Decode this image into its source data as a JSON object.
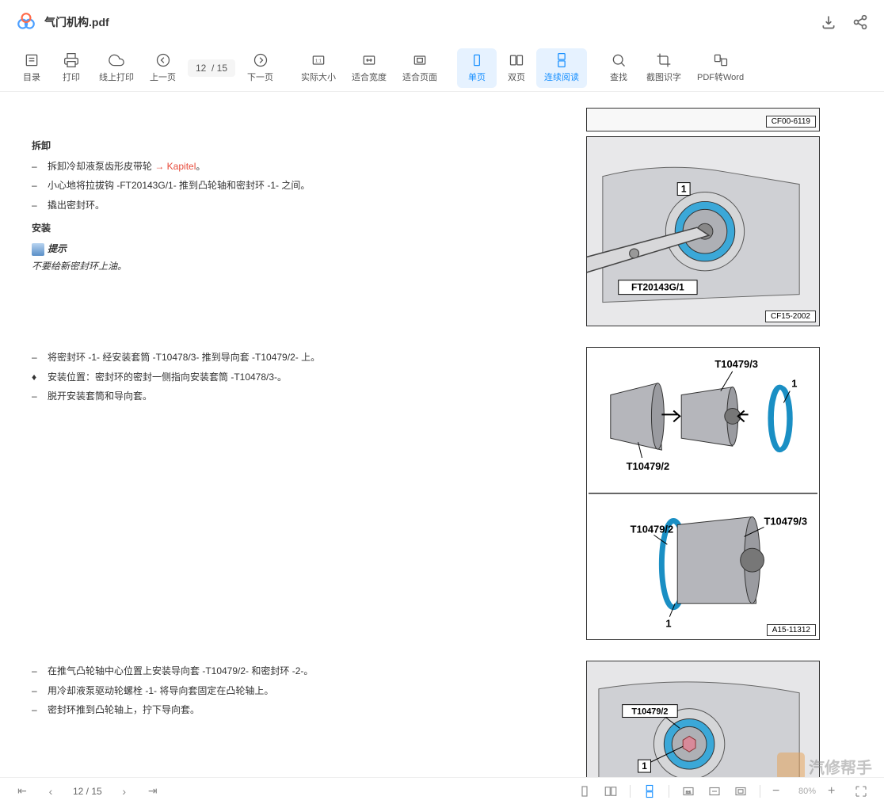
{
  "header": {
    "filename": "气门机构.pdf"
  },
  "toolbar": {
    "items": [
      {
        "label": "目录",
        "icon": "toc"
      },
      {
        "label": "打印",
        "icon": "print"
      },
      {
        "label": "线上打印",
        "icon": "cloud-print"
      },
      {
        "label": "上一页",
        "icon": "prev"
      }
    ],
    "page_display": "12  / 15",
    "items2": [
      {
        "label": "下一页",
        "icon": "next"
      },
      {
        "label": "实际大小",
        "icon": "actual"
      },
      {
        "label": "适合宽度",
        "icon": "fit-width"
      },
      {
        "label": "适合页面",
        "icon": "fit-page"
      },
      {
        "label": "单页",
        "icon": "single",
        "active": true
      },
      {
        "label": "双页",
        "icon": "double"
      },
      {
        "label": "连续阅读",
        "icon": "continuous",
        "active": true
      },
      {
        "label": "查找",
        "icon": "search"
      },
      {
        "label": "截图识字",
        "icon": "crop"
      },
      {
        "label": "PDF转Word",
        "icon": "convert"
      }
    ]
  },
  "document": {
    "section1": {
      "heading1": "拆卸",
      "items1": [
        {
          "text_pre": "拆卸冷却液泵齿形皮带轮 ",
          "link": "→ Kapitel",
          "text_post": "。"
        },
        {
          "text": "小心地将拉拔钩 -FT20143G/1- 推到凸轮轴和密封环 -1- 之间。"
        },
        {
          "text": "撬出密封环。"
        }
      ],
      "heading2": "安装",
      "note_title": "提示",
      "note_text": "不要给新密封环上油。"
    },
    "section2": {
      "items": [
        {
          "bullet": "–",
          "text": "将密封环 -1- 经安装套筒 -T10478/3- 推到导向套 -T10479/2- 上。"
        },
        {
          "bullet": "♦",
          "text": "安装位置：密封环的密封一侧指向安装套筒 -T10478/3-。"
        },
        {
          "bullet": "–",
          "text": "脱开安装套筒和导向套。"
        }
      ]
    },
    "section3": {
      "items": [
        {
          "bullet": "–",
          "text": "在推气凸轮轴中心位置上安装导向套 -T10479/2- 和密封环 -2-。"
        },
        {
          "bullet": "–",
          "text": "用冷却液泵驱动轮螺栓 -1- 将导向套固定在凸轮轴上。"
        },
        {
          "bullet": "–",
          "text": "密封环推到凸轮轴上，拧下导向套。"
        }
      ]
    },
    "figures": {
      "fig0": {
        "label": "CF00-6119"
      },
      "fig1": {
        "label": "CF15-2002",
        "callout1": "1",
        "callout2": "FT20143G/1"
      },
      "fig2": {
        "label": "A15-11312",
        "t1": "T10479/3",
        "t2": "T10479/2",
        "t3": "1",
        "t4": "T10479/2",
        "t5": "T10479/3",
        "t6": "1"
      },
      "fig3": {
        "callout": "T10479/2",
        "num": "1"
      }
    }
  },
  "watermark": {
    "text": "汽修帮手"
  },
  "footer": {
    "page": "12  / 15",
    "zoom": "80%"
  }
}
